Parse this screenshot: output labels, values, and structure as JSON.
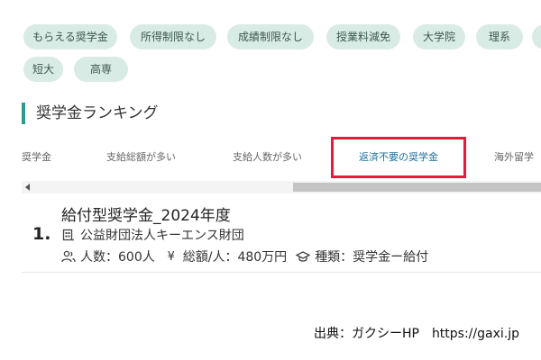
{
  "tags": [
    "もらえる奨学金",
    "所得制限なし",
    "成績制限なし",
    "授業料減免",
    "大学院",
    "理系",
    "短大",
    "高専"
  ],
  "section_title": "奨学金ランキング",
  "tabs": [
    {
      "label": "奨学金",
      "active": false
    },
    {
      "label": "支給総額が多い",
      "active": false
    },
    {
      "label": "支給人数が多い",
      "active": false
    },
    {
      "label": "返済不要の奨学金",
      "active": true
    },
    {
      "label": "海外留学",
      "active": false
    }
  ],
  "colors": {
    "tag_bg": "#d9ebe5",
    "accent": "#2e9a8c",
    "highlight": "#e8193c",
    "active_tab": "#1f6f9f"
  },
  "ranking": {
    "rank": "1.",
    "title": "給付型奨学金_2024年度",
    "organization": "公益財団法人キーエンス財団",
    "people": "人数：600人",
    "amount": "総額/人：480万円",
    "type": "種類：奨学金ー給付"
  },
  "source": "出典：ガクシーHP　https://gaxi.jp"
}
